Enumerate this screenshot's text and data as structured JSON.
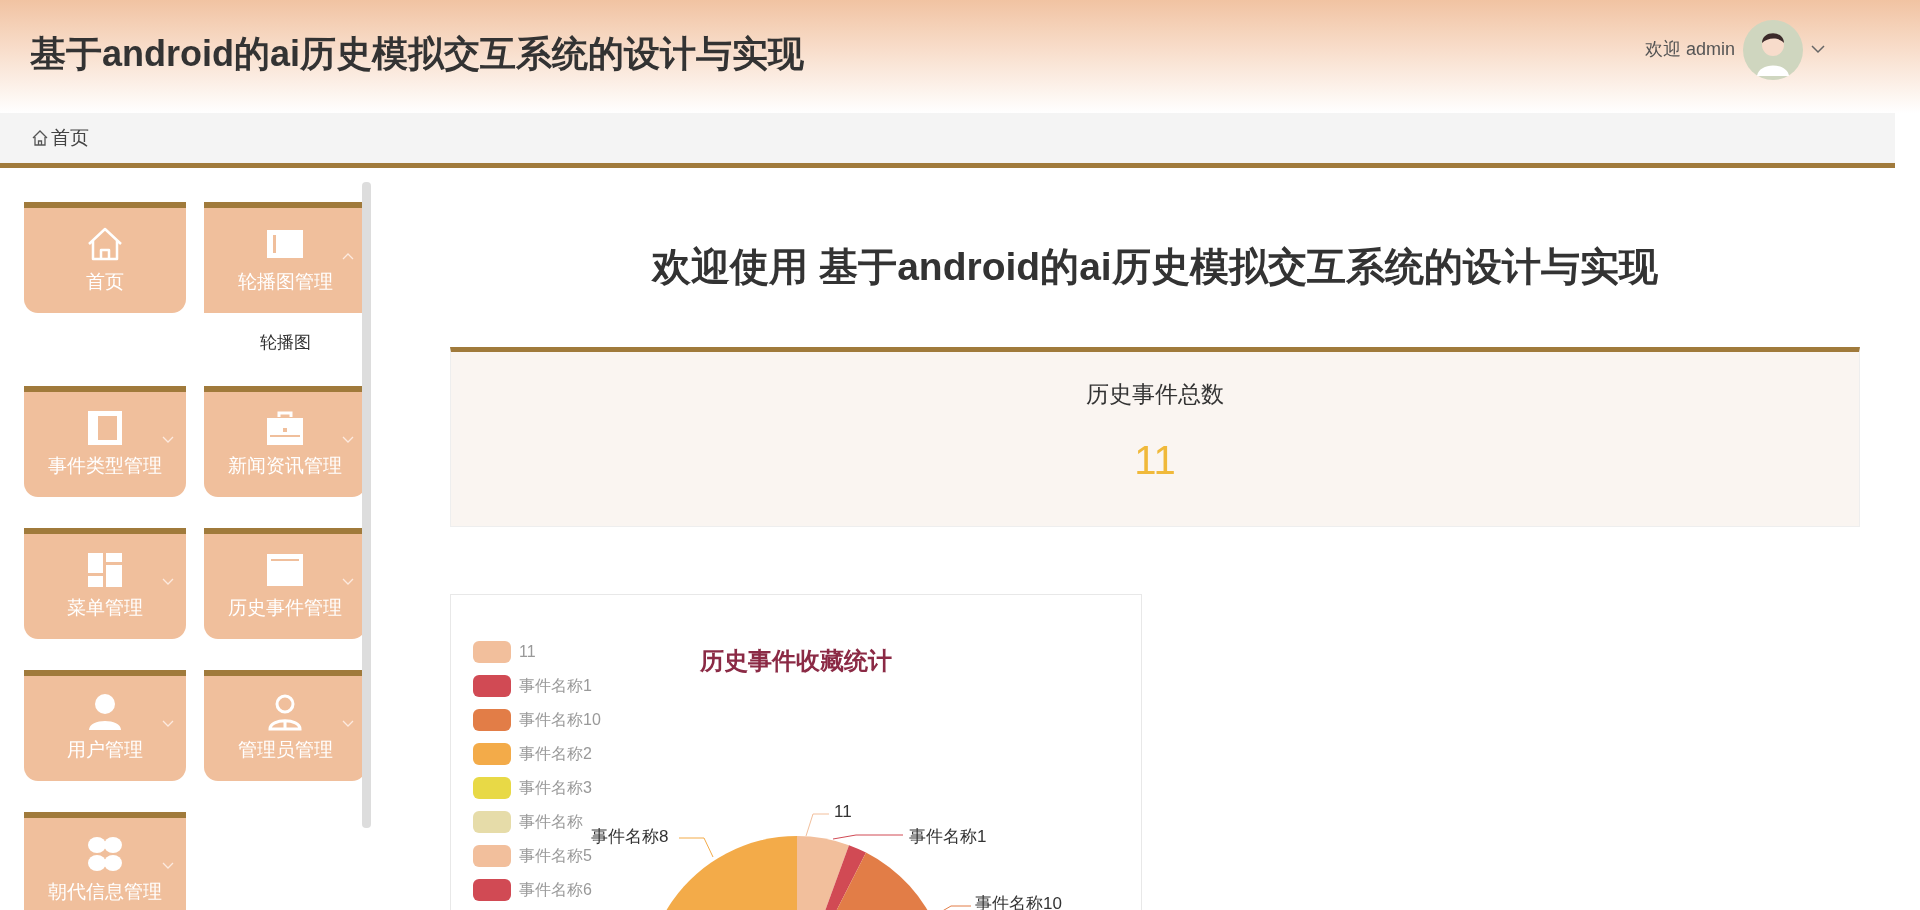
{
  "header": {
    "title": "基于android的ai历史模拟交互系统的设计与实现",
    "greeting": "欢迎 admin"
  },
  "breadcrumb": [
    {
      "label": "首页"
    }
  ],
  "sidebar": {
    "items": [
      {
        "label": "首页",
        "kind": "link"
      },
      {
        "label": "轮播图管理",
        "kind": "menu",
        "expanded": true,
        "children": [
          {
            "label": "轮播图"
          }
        ]
      },
      {
        "label": "事件类型管理",
        "kind": "menu",
        "expanded": false
      },
      {
        "label": "新闻资讯管理",
        "kind": "menu",
        "expanded": false
      },
      {
        "label": "菜单管理",
        "kind": "menu",
        "expanded": false
      },
      {
        "label": "历史事件管理",
        "kind": "menu",
        "expanded": false
      },
      {
        "label": "用户管理",
        "kind": "menu",
        "expanded": false
      },
      {
        "label": "管理员管理",
        "kind": "menu",
        "expanded": false
      },
      {
        "label": "朝代信息管理",
        "kind": "menu",
        "expanded": false
      }
    ]
  },
  "welcome": {
    "title": "欢迎使用 基于android的ai历史模拟交互系统的设计与实现"
  },
  "stat_card": {
    "label": "历史事件总数",
    "value": "11"
  },
  "chart": {
    "title": "历史事件收藏统计",
    "legend": [
      {
        "label": "11",
        "color": "#f2bf9c"
      },
      {
        "label": "事件名称1",
        "color": "#d14a54"
      },
      {
        "label": "事件名称10",
        "color": "#e27d47"
      },
      {
        "label": "事件名称2",
        "color": "#f3ab49"
      },
      {
        "label": "事件名称3",
        "color": "#e8d946"
      },
      {
        "label": "事件名称",
        "color": "#e6dca9"
      },
      {
        "label": "事件名称5",
        "color": "#f2bf9c"
      },
      {
        "label": "事件名称6",
        "color": "#d14a54"
      }
    ],
    "slice_labels": [
      "11",
      "事件名称1",
      "事件名称8",
      "事件名称10"
    ]
  }
}
